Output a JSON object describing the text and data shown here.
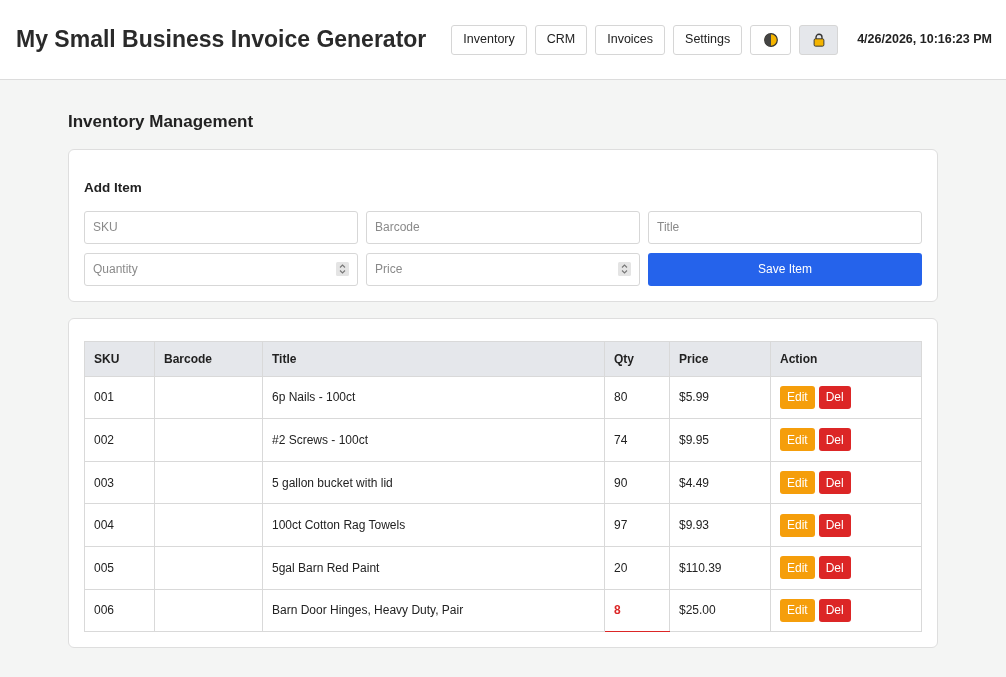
{
  "header": {
    "title": "My Small Business Invoice Generator",
    "nav": [
      {
        "kind": "text",
        "label": "Inventory",
        "pressed": false
      },
      {
        "kind": "text",
        "label": "CRM",
        "pressed": false
      },
      {
        "kind": "text",
        "label": "Invoices",
        "pressed": false
      },
      {
        "kind": "text",
        "label": "Settings",
        "pressed": false
      },
      {
        "kind": "theme",
        "pressed": false
      },
      {
        "kind": "lock",
        "pressed": true
      }
    ],
    "datetime": "4/26/2026, 10:16:23 PM"
  },
  "page": {
    "heading": "Inventory Management"
  },
  "add_item": {
    "title": "Add Item",
    "fields": [
      {
        "kind": "text",
        "placeholder": "SKU"
      },
      {
        "kind": "text",
        "placeholder": "Barcode"
      },
      {
        "kind": "text",
        "placeholder": "Title"
      },
      {
        "kind": "number",
        "placeholder": "Quantity"
      },
      {
        "kind": "number",
        "placeholder": "Price"
      }
    ],
    "save_button": "Save Item"
  },
  "table": {
    "columns": [
      "SKU",
      "Barcode",
      "Title",
      "Qty",
      "Price",
      "Action"
    ],
    "rows": [
      {
        "sku": "001",
        "title": "6p Nails - 100ct",
        "qty": "80",
        "price": "$5.99",
        "low_stock": false,
        "actions": [
          {
            "kind": "edit",
            "label": "Edit"
          },
          {
            "kind": "delete",
            "label": "Del"
          }
        ]
      },
      {
        "sku": "002",
        "title": "#2 Screws - 100ct",
        "qty": "74",
        "price": "$9.95",
        "low_stock": false,
        "actions": [
          {
            "kind": "edit",
            "label": "Edit"
          },
          {
            "kind": "delete",
            "label": "Del"
          }
        ]
      },
      {
        "sku": "003",
        "title": "5 gallon bucket with lid",
        "qty": "90",
        "price": "$4.49",
        "low_stock": false,
        "actions": [
          {
            "kind": "edit",
            "label": "Edit"
          },
          {
            "kind": "delete",
            "label": "Del"
          }
        ]
      },
      {
        "sku": "004",
        "title": "100ct Cotton Rag Towels",
        "qty": "97",
        "price": "$9.93",
        "low_stock": false,
        "actions": [
          {
            "kind": "edit",
            "label": "Edit"
          },
          {
            "kind": "delete",
            "label": "Del"
          }
        ]
      },
      {
        "sku": "005",
        "title": "5gal Barn Red Paint",
        "qty": "20",
        "price": "$110.39",
        "low_stock": false,
        "actions": [
          {
            "kind": "edit",
            "label": "Edit"
          },
          {
            "kind": "delete",
            "label": "Del"
          }
        ]
      },
      {
        "sku": "006",
        "title": "Barn Door Hinges, Heavy Duty, Pair",
        "qty": "8",
        "price": "$25.00",
        "low_stock": true,
        "actions": [
          {
            "kind": "edit",
            "label": "Edit"
          },
          {
            "kind": "delete",
            "label": "Del"
          }
        ]
      }
    ]
  }
}
